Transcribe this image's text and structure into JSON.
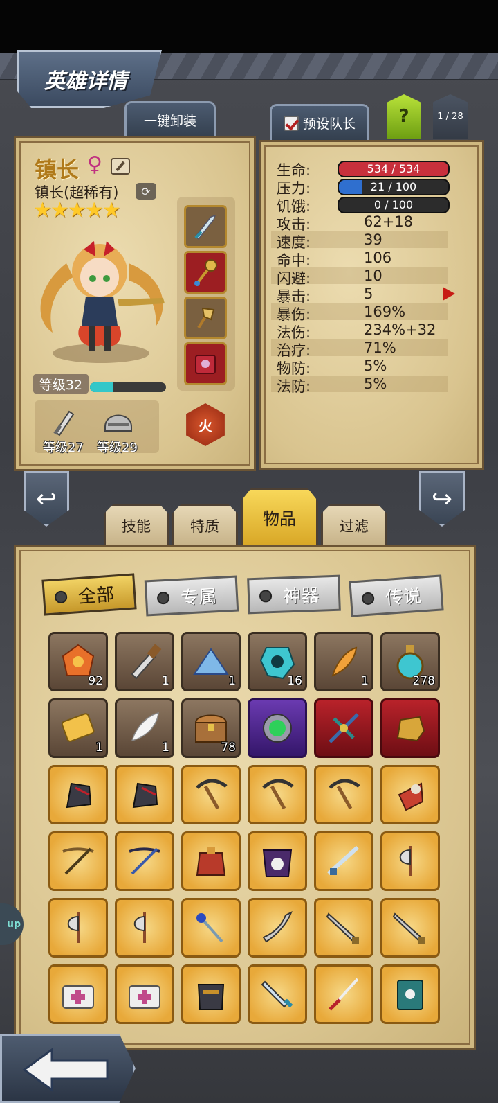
{
  "screen": {
    "title": "英雄详情",
    "unequip_all_label": "一键卸装",
    "preset_leader_label": "预设队长",
    "help_label": "?",
    "page_counter": "1 / 28"
  },
  "hero": {
    "name": "镇长",
    "class_label": "镇长(超稀有)",
    "stars": "★★★★★",
    "star_count": 5,
    "level_label": "等级32",
    "xp_fraction": 0.3,
    "weapon_level_label": "等级27",
    "armor_level_label": "等级29",
    "element_label": "火"
  },
  "stats": {
    "hp": {
      "label": "生命:",
      "value": "534 / 534",
      "fraction": 1.0
    },
    "stress": {
      "label": "压力:",
      "value": "21 / 100",
      "fraction": 0.21
    },
    "hunger": {
      "label": "饥饿:",
      "value": "0 / 100",
      "fraction": 0.0
    },
    "rows": [
      {
        "label": "攻击:",
        "value": "62+18"
      },
      {
        "label": "速度:",
        "value": "39"
      },
      {
        "label": "命中:",
        "value": "106"
      },
      {
        "label": "闪避:",
        "value": "10"
      },
      {
        "label": "暴击:",
        "value": "5"
      },
      {
        "label": "暴伤:",
        "value": "169%"
      },
      {
        "label": "法伤:",
        "value": "234%+32"
      },
      {
        "label": "治疗:",
        "value": "71%"
      },
      {
        "label": "物防:",
        "value": "5%"
      },
      {
        "label": "法防:",
        "value": "5%"
      }
    ]
  },
  "tabs": {
    "skills": "技能",
    "traits": "特质",
    "items": "物品",
    "filter": "过滤"
  },
  "filters": {
    "all": "全部",
    "exclusive": "专属",
    "artifact": "神器",
    "legend": "传说"
  },
  "inventory": {
    "row1": [
      "92",
      "1",
      "1",
      "16",
      "1",
      "278"
    ],
    "row2": [
      "1",
      "1",
      "78",
      "",
      "",
      ""
    ]
  },
  "side_tag": "up"
}
